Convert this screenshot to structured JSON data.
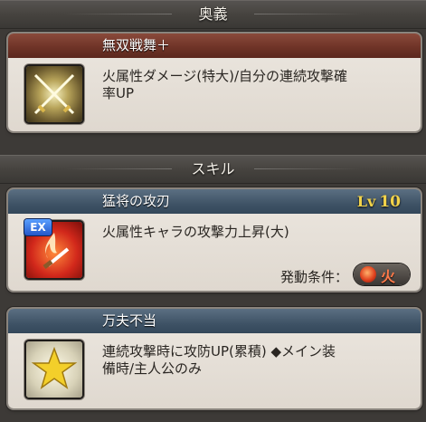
{
  "ougi": {
    "header": "奥義",
    "name": "無双戦舞＋",
    "desc_line1": "火属性ダメージ(特大)/自分の連続攻撃確",
    "desc_line2": "率UP",
    "icon": "crossed-swords-icon"
  },
  "skills": {
    "header": "スキル",
    "items": [
      {
        "name": "猛将の攻刃",
        "lv_label": "Lv",
        "lv_value": "10",
        "desc_line1": "火属性キャラの攻撃力上昇(大)",
        "desc_line2": "",
        "badge": "EX",
        "condition_label": "発動条件：",
        "condition_value": "火",
        "icon": "fire-sword-icon"
      },
      {
        "name": "万夫不当",
        "desc_line1": "連続攻撃時に攻防UP(累積) ◆メイン装",
        "desc_line2": "備時/主人公のみ",
        "icon": "star-icon"
      }
    ]
  },
  "colors": {
    "ougi_title_bar": "#6d3226",
    "skill_title_bar": "#3f5366",
    "level_text": "#f2d34a",
    "fire_text": "#ff7a4a"
  }
}
